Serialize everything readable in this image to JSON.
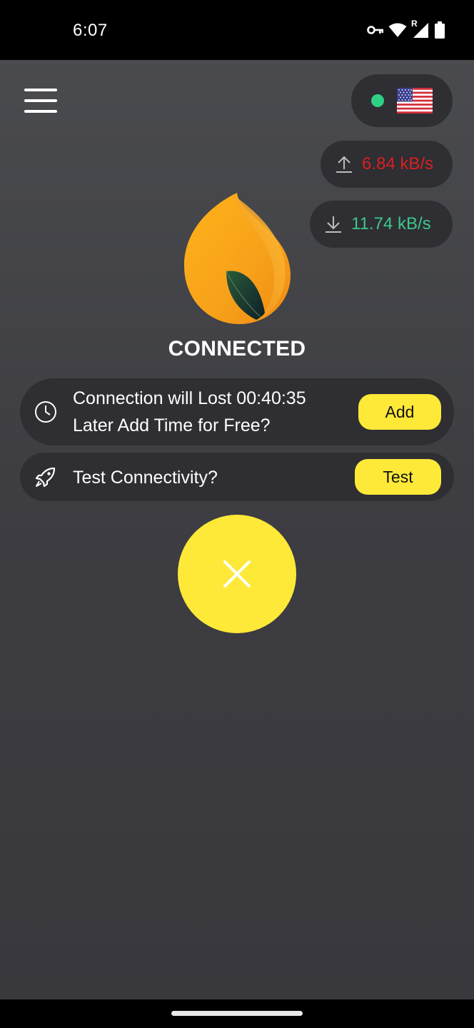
{
  "status_bar": {
    "time": "6:07",
    "icons": [
      "vpn-key-icon",
      "wifi-icon",
      "signal-roaming-icon",
      "battery-icon"
    ],
    "roaming_label": "R"
  },
  "header": {
    "menu_icon": "hamburger-menu-icon",
    "server": {
      "status_color": "#2fcf84",
      "flag_icon": "us-flag-icon"
    }
  },
  "speeds": {
    "upload": {
      "icon": "upload-icon",
      "value": "6.84 kB/s",
      "color": "#d9201f"
    },
    "download": {
      "icon": "download-icon",
      "value": "11.74 kB/s",
      "color": "#3cc88c"
    }
  },
  "logo_icon": "flame-leaf-logo",
  "status": {
    "label": "CONNECTED"
  },
  "time_card": {
    "icon": "clock-icon",
    "line1": "Connection will Lost 00:40:35",
    "line2": "Later Add Time for Free?",
    "button_label": "Add"
  },
  "test_card": {
    "icon": "rocket-icon",
    "label": "Test Connectivity?",
    "button_label": "Test"
  },
  "disconnect": {
    "icon": "close-icon"
  },
  "colors": {
    "accent": "#ffe938",
    "card_bg": "#2e2e33",
    "background_top": "#4a4b4f",
    "background_bottom": "#38383d"
  }
}
